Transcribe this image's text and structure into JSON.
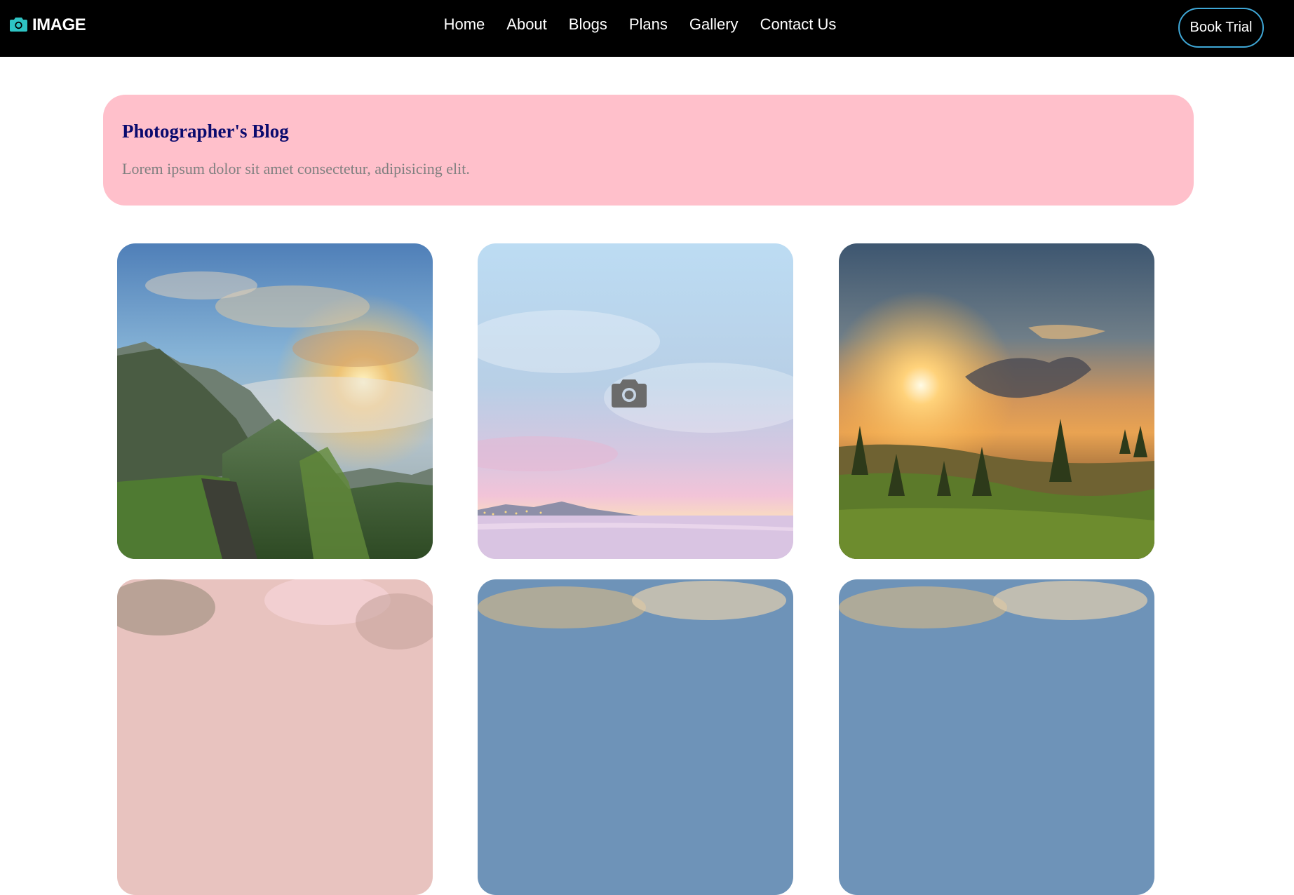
{
  "brand": {
    "name": "IMAGE",
    "icon": "camera-icon",
    "accent": "#2ec4c4"
  },
  "nav": {
    "links": [
      "Home",
      "About",
      "Blogs",
      "Plans",
      "Gallery",
      "Contact Us"
    ],
    "cta": "Book Trial"
  },
  "hero": {
    "title": "Photographer's Blog",
    "subtitle": "Lorem ipsum dolor sit amet consectetur, adipisicing elit.",
    "background": "#ffc0cb",
    "title_color": "#0b0b6e"
  },
  "gallery": {
    "photos": [
      "mountain-cliff-sunrise",
      "pink-sky-sea-horizon",
      "golden-sunset-trees",
      "pink-blossoms",
      "cloudy-sky",
      "cloudy-sky"
    ],
    "overlay_icon": "camera-icon"
  }
}
